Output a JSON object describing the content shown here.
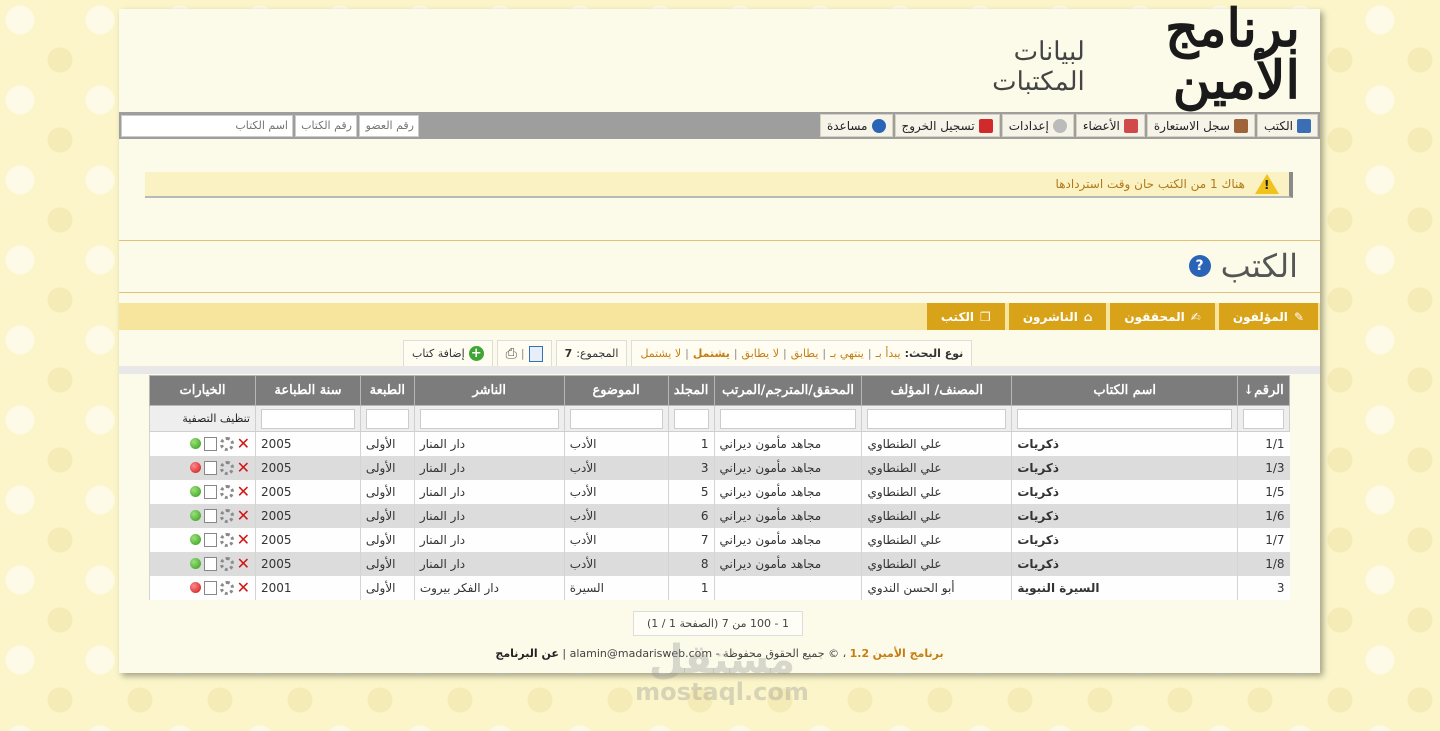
{
  "header": {
    "logo_main": "برنامج الأمين",
    "logo_sub": "لبيانات المكتبات"
  },
  "nav": {
    "items": [
      {
        "label": "الكتب",
        "icon": "book-icon"
      },
      {
        "label": "سجل الاستعارة",
        "icon": "borrow-icon"
      },
      {
        "label": "الأعضاء",
        "icon": "members-icon"
      },
      {
        "label": "إعدادات",
        "icon": "gear-icon"
      },
      {
        "label": "تسجيل الخروج",
        "icon": "logout-icon"
      },
      {
        "label": "مساعدة",
        "icon": "help-icon"
      }
    ],
    "search": {
      "member_placeholder": "رقم العضو",
      "book_no_placeholder": "رقم الكتاب",
      "book_name_placeholder": "اسم الكتاب"
    }
  },
  "notice": {
    "text": "هناك 1 من الكتب حان وقت استردادها"
  },
  "page": {
    "title": "الكتب",
    "help": "?"
  },
  "tabs": [
    {
      "label": "المؤلفون",
      "icon": "pen-icon"
    },
    {
      "label": "المحققون",
      "icon": "edit-icon"
    },
    {
      "label": "الناشرون",
      "icon": "building-icon"
    },
    {
      "label": "الكتب",
      "icon": "book-icon"
    }
  ],
  "toolbar": {
    "search_type_label": "نوع البحث:",
    "options": [
      "يبدأ بـ",
      "ينتهي بـ",
      "يطابق",
      "لا يطابق",
      "يشتمل",
      "لا يشتمل"
    ],
    "total_label": "المجموع:",
    "total_value": "7",
    "add_label": "إضافة كتاب"
  },
  "table": {
    "headers": [
      "الرقم↓",
      "اسم الكتاب",
      "المصنف/ المؤلف",
      "المحقق/المترجم/المرتب",
      "المجلد",
      "الموضوع",
      "الناشر",
      "الطبعة",
      "سنة الطباعة",
      "الخيارات"
    ],
    "clear_filter": "تنظيف التصفية",
    "rows": [
      {
        "id": "1/1",
        "title": "ذكريات",
        "author": "علي الطنطاوي",
        "editor": "مجاهد مأمون ديراني",
        "volume": "1",
        "subject": "الأدب",
        "publisher": "دار المنار",
        "edition": "الأولى",
        "year": "2005",
        "status": "green"
      },
      {
        "id": "1/3",
        "title": "ذكريات",
        "author": "علي الطنطاوي",
        "editor": "مجاهد مأمون ديراني",
        "volume": "3",
        "subject": "الأدب",
        "publisher": "دار المنار",
        "edition": "الأولى",
        "year": "2005",
        "status": "red"
      },
      {
        "id": "1/5",
        "title": "ذكريات",
        "author": "علي الطنطاوي",
        "editor": "مجاهد مأمون ديراني",
        "volume": "5",
        "subject": "الأدب",
        "publisher": "دار المنار",
        "edition": "الأولى",
        "year": "2005",
        "status": "green"
      },
      {
        "id": "1/6",
        "title": "ذكريات",
        "author": "علي الطنطاوي",
        "editor": "مجاهد مأمون ديراني",
        "volume": "6",
        "subject": "الأدب",
        "publisher": "دار المنار",
        "edition": "الأولى",
        "year": "2005",
        "status": "green"
      },
      {
        "id": "1/7",
        "title": "ذكريات",
        "author": "علي الطنطاوي",
        "editor": "مجاهد مأمون ديراني",
        "volume": "7",
        "subject": "الأدب",
        "publisher": "دار المنار",
        "edition": "الأولى",
        "year": "2005",
        "status": "green"
      },
      {
        "id": "1/8",
        "title": "ذكريات",
        "author": "علي الطنطاوي",
        "editor": "مجاهد مأمون ديراني",
        "volume": "8",
        "subject": "الأدب",
        "publisher": "دار المنار",
        "edition": "الأولى",
        "year": "2005",
        "status": "green"
      },
      {
        "id": "3",
        "title": "السيرة النبوية",
        "author": "أبو الحسن الندوي",
        "editor": "",
        "volume": "1",
        "subject": "السيرة",
        "publisher": "دار الفكر بيروت",
        "edition": "الأولى",
        "year": "2001",
        "status": "red"
      }
    ]
  },
  "pager": {
    "text": "1 - 100 من 7 (الصفحة 1 / 1)"
  },
  "footer": {
    "brand": "برنامج الأمين",
    "version": "1.2",
    "rights": "، © جميع الحقوق محفوظة - alamin@madarisweb.com |",
    "about": "عن البرنامج"
  },
  "watermark": {
    "line1": "مستقل",
    "line2": "mostaql.com"
  },
  "colors": {
    "accent": "#d9a319",
    "nav_bg": "#9e9e9e",
    "header_th": "#7c7c7c",
    "link": "#c57d12"
  }
}
